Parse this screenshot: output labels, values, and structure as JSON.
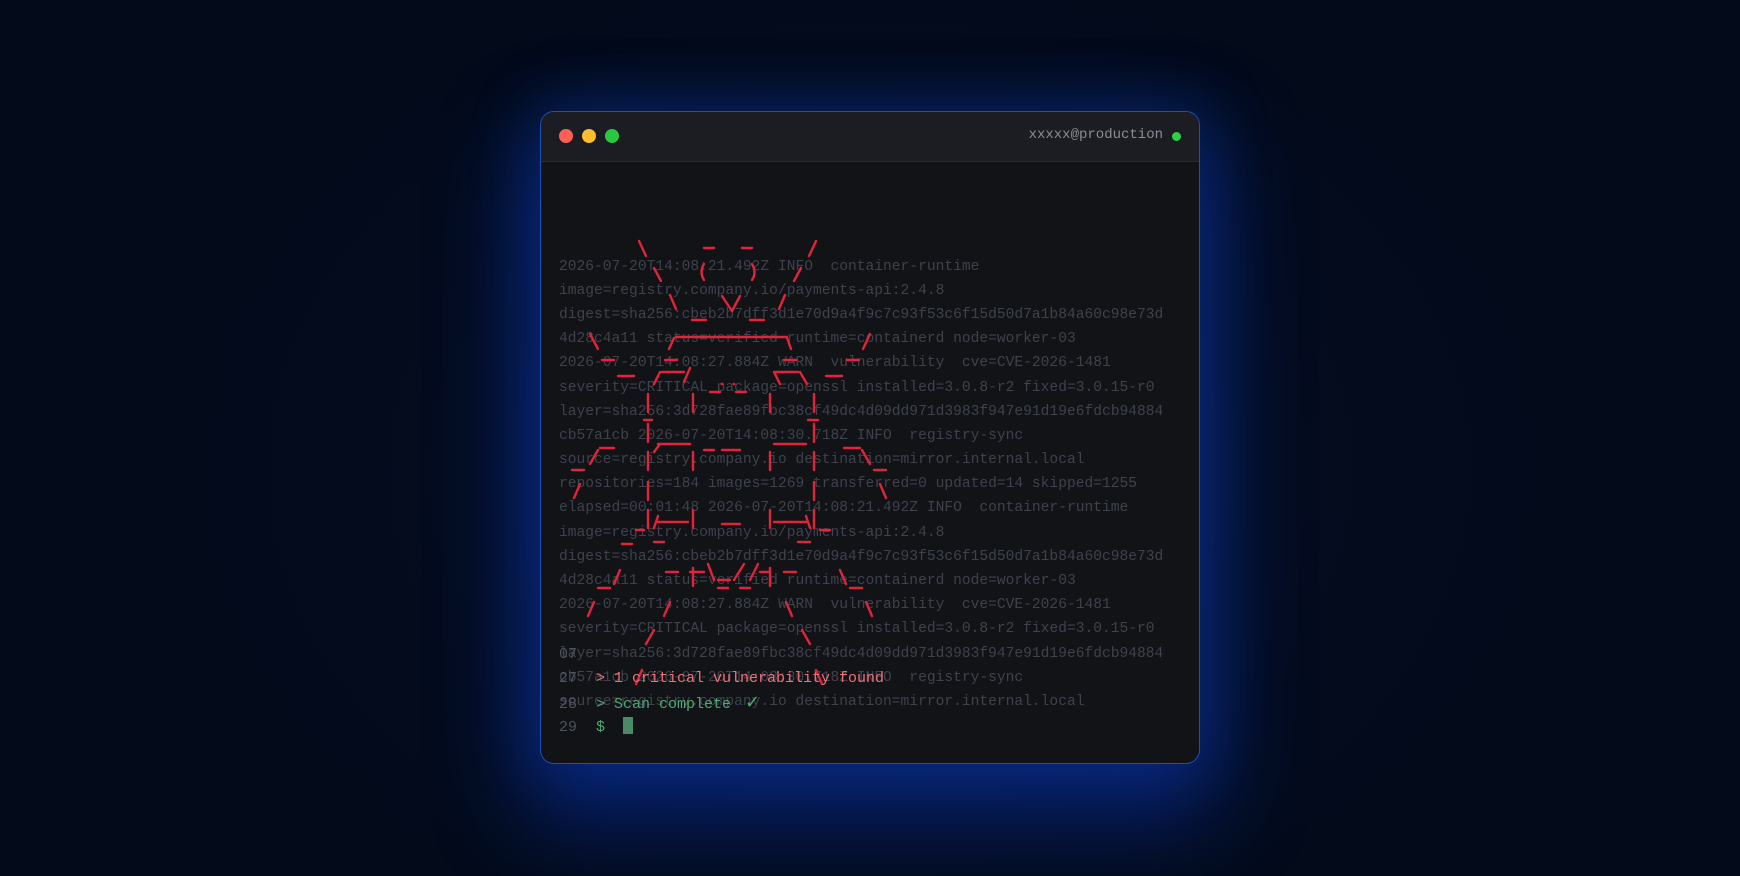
{
  "window": {
    "host": "xxxxx@production",
    "status": "online"
  },
  "log_lines": [
    "2026-07-20T14:08:21.492Z INFO  container-runtime",
    "image=registry.company.io/payments-api:2.4.8",
    "digest=sha256:cbeb2b7dff3d1e70d9a4f9c7c93f53c6f15d50d7a1b84a60c98e73d",
    "4d28c4a11 status=verified runtime=containerd node=worker-03",
    "2026-07-20T14:08:27.884Z WARN  vulnerability  cve=CVE-2026-1481",
    "severity=CRITICAL package=openssl installed=3.0.8-r2 fixed=3.0.15-r0",
    "layer=sha256:3d728fae89fbc38cf49dc4d09dd971d3983f947e91d19e6fdcb94884",
    "cb57a1cb 2026-07-20T14:08:30.718Z INFO  registry-sync",
    "source=registry.company.io destination=mirror.internal.local",
    "repositories=184 images=1269 transferred=0 updated=14 skipped=1255",
    "elapsed=00:01:48 2026-07-20T14:08:21.492Z INFO  container-runtime",
    "image=registry.company.io/payments-api:2.4.8",
    "digest=sha256:cbeb2b7dff3d1e70d9a4f9c7c93f53c6f15d50d7a1b84a60c98e73d",
    "4d28c4a11 status=verified runtime=containerd node=worker-03",
    "2026-07-20T14:08:27.884Z WARN  vulnerability  cve=CVE-2026-1481",
    "severity=CRITICAL package=openssl installed=3.0.8-r2 fixed=3.0.15-r0",
    "layer=sha256:3d728fae89fbc38cf49dc4d09dd971d3983f947e91d19e6fdcb94884",
    "cb57a1cb 2026-07-20T14:08:30.718Z INFO  registry-sync",
    "source=registry.company.io destination=mirror.internal.local"
  ],
  "prompt": {
    "lines": [
      {
        "num": "07",
        "text": "",
        "kind": "plain"
      },
      {
        "num": "27",
        "text": "> 1 critical vulnerability found",
        "kind": "critical"
      },
      {
        "num": "28",
        "text": "> Scan complete",
        "kind": "success"
      },
      {
        "num": "29",
        "text": "$",
        "kind": "input"
      }
    ],
    "check_glyph": "✓"
  },
  "colors": {
    "accent_border": "#1f4fb0",
    "critical": "#f07178",
    "success": "#4fa972",
    "bug_art": "#e0243a",
    "log_text": "#3d424c"
  },
  "icons": {
    "bug_art": "bug-ascii-art",
    "status": "status-dot-icon",
    "check": "checkmark-icon",
    "cursor": "cursor-block-icon"
  }
}
